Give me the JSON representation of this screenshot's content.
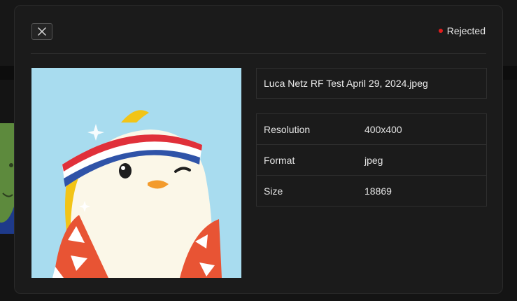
{
  "modal": {
    "close_label": "close",
    "status": {
      "label": "Rejected",
      "color": "#e11d1d"
    },
    "file_name": "Luca Netz RF Test April 29, 2024.jpeg",
    "properties": [
      {
        "key": "Resolution",
        "value": "400x400"
      },
      {
        "key": "Format",
        "value": "jpeg"
      },
      {
        "key": "Size",
        "value": "18869"
      }
    ]
  },
  "colors": {
    "page_bg": "#141414",
    "modal_bg": "#1b1b1b",
    "border": "#2e2e2e",
    "preview_bg": "#a8dcef"
  }
}
